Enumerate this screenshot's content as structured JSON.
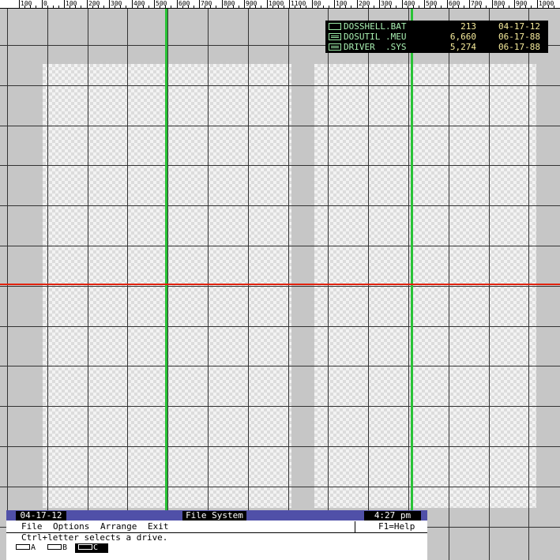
{
  "ruler": {
    "labels": [
      "100",
      "0",
      "100",
      "200",
      "300",
      "400",
      "500",
      "600",
      "700",
      "800",
      "900",
      "1000",
      "1100",
      "00",
      "100",
      "200",
      "300",
      "400",
      "500",
      "600",
      "700",
      "800",
      "900",
      "1000"
    ]
  },
  "file_list": [
    {
      "icon": "program-file-icon",
      "name": "DOSSHELL.BAT",
      "size": "213",
      "date": "04-17-12"
    },
    {
      "icon": "document-file-icon",
      "name": "DOSUTIL .MEU",
      "size": "6,660",
      "date": "06-17-88"
    },
    {
      "icon": "document-file-icon",
      "name": "DRIVER  .SYS",
      "size": "5,274",
      "date": "06-17-88"
    }
  ],
  "shell": {
    "date": "04-17-12",
    "title": "File System",
    "time": "4:27 pm",
    "menu": {
      "file": "File",
      "options": "Options",
      "arrange": "Arrange",
      "exit": "Exit",
      "help": "F1=Help"
    },
    "hint": "Ctrl+letter selects a drive.",
    "drives": [
      {
        "label": "A",
        "selected": false
      },
      {
        "label": "B",
        "selected": false
      },
      {
        "label": "C",
        "selected": true
      }
    ]
  },
  "colors": {
    "background": "#c6c6c6",
    "guide_vertical": "#29c236",
    "guide_horizontal": "#e2230e",
    "status_bar": "#5050a8",
    "file_name": "#a9f0b2",
    "file_meta": "#f6eb9b"
  }
}
